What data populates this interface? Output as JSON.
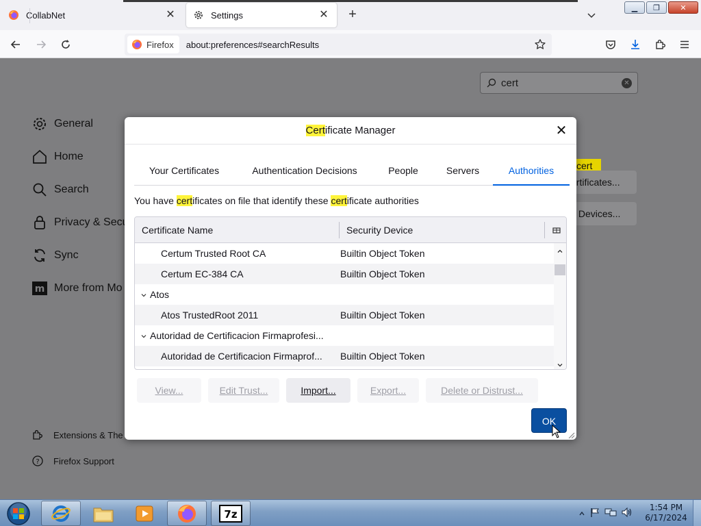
{
  "browser": {
    "tabs": [
      {
        "label": "CollabNet",
        "active": false
      },
      {
        "label": "Settings",
        "active": true
      }
    ],
    "identity_label": "Firefox",
    "url": "about:preferences#searchResults"
  },
  "settings": {
    "search_value": "cert",
    "categories": [
      {
        "label": "General",
        "icon": "gear-icon"
      },
      {
        "label": "Home",
        "icon": "home-icon"
      },
      {
        "label": "Search",
        "icon": "search-icon"
      },
      {
        "label": "Privacy & Secu",
        "icon": "lock-icon"
      },
      {
        "label": "Sync",
        "icon": "sync-icon"
      },
      {
        "label": "More from Mo",
        "icon": "mozilla-icon"
      }
    ],
    "footer": [
      {
        "label": "Extensions & The",
        "icon": "puzzle-icon"
      },
      {
        "label": "Firefox Support",
        "icon": "help-icon"
      }
    ],
    "bg_highlight": "cert",
    "bg_view_certs": "ertificates...",
    "bg_security_devices": "y Devices..."
  },
  "dialog": {
    "title_hl": "Cert",
    "title_rest": "ificate Manager",
    "tabs": [
      "Your Certificates",
      "Authentication Decisions",
      "People",
      "Servers",
      "Authorities"
    ],
    "active_tab": "Authorities",
    "desc": {
      "p1": "You have ",
      "hl1": "cert",
      "p2": "ificates on file that identify these ",
      "hl2": "cert",
      "p3": "ificate authorities"
    },
    "columns": [
      "Certificate Name",
      "Security Device"
    ],
    "rows": [
      {
        "name": "Certum Trusted Root CA",
        "device": "Builtin Object Token",
        "group": false
      },
      {
        "name": "Certum EC-384 CA",
        "device": "Builtin Object Token",
        "group": false
      },
      {
        "name": "Atos",
        "device": "",
        "group": true
      },
      {
        "name": "Atos TrustedRoot 2011",
        "device": "Builtin Object Token",
        "group": false
      },
      {
        "name": "Autoridad de Certificacion Firmaprofesi...",
        "device": "",
        "group": true
      },
      {
        "name": "Autoridad de Certificacion Firmaprof...",
        "device": "Builtin Object Token",
        "group": false
      }
    ],
    "buttons": {
      "view": "View...",
      "edit_trust": "Edit Trust...",
      "import": "Import...",
      "export": "Export...",
      "delete": "Delete or Distrust..."
    },
    "ok": "OK"
  },
  "taskbar": {
    "time": "1:54 PM",
    "date": "6/17/2024",
    "apps": [
      "start-orb",
      "internet-explorer-icon",
      "file-explorer-icon",
      "media-player-icon",
      "firefox-icon",
      "7zip-icon"
    ]
  },
  "colors": {
    "accent": "#0061e0",
    "ok_button": "#0a4fa0",
    "highlight": "#fff43a"
  }
}
